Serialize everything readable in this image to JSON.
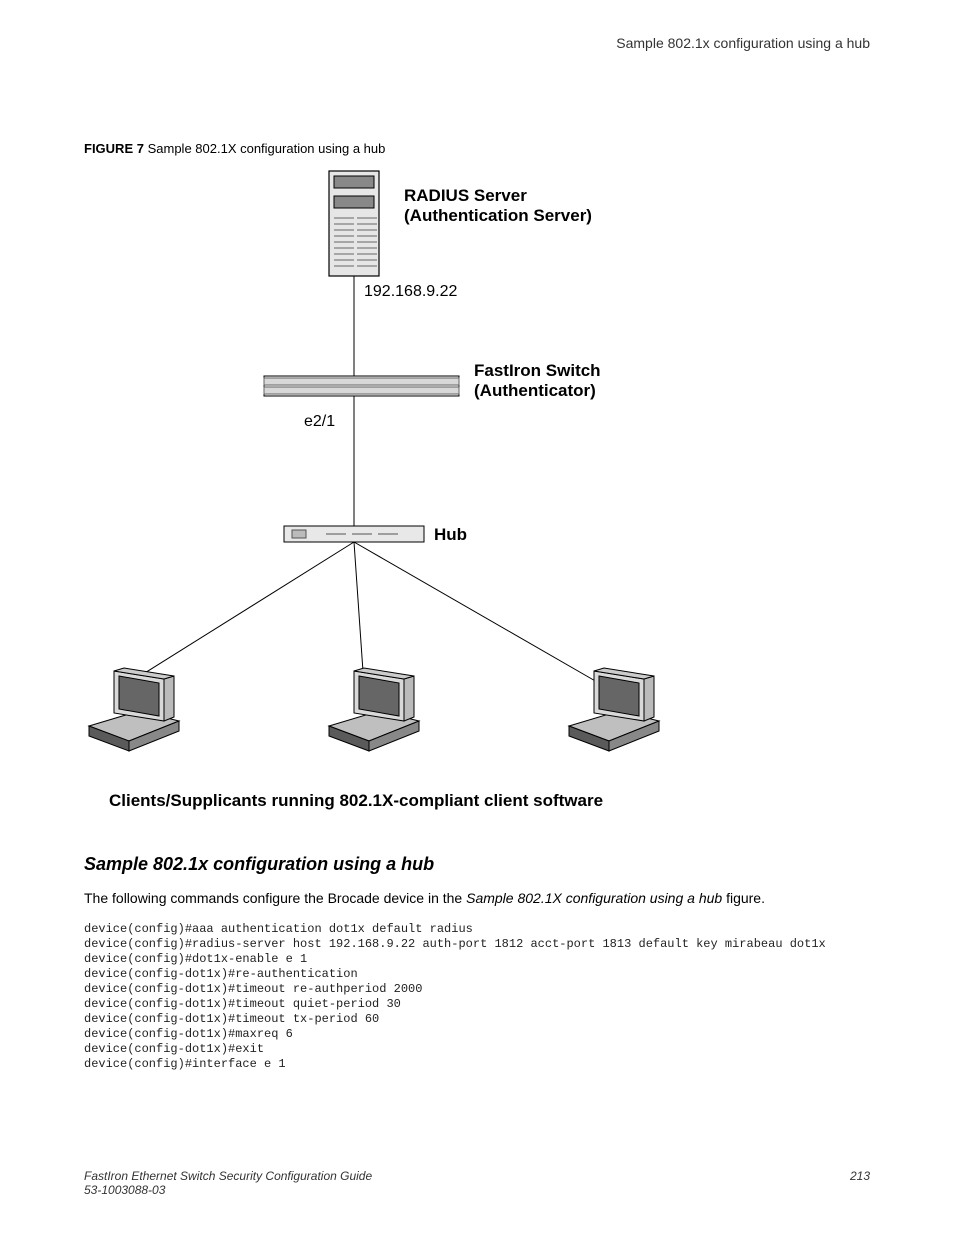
{
  "header": {
    "right_text": "Sample 802.1x configuration using a hub"
  },
  "figure": {
    "label": "FIGURE 7",
    "caption": "Sample 802.1X configuration using a hub",
    "labels": {
      "radius_title": "RADIUS Server",
      "radius_sub": "(Authentication Server)",
      "ip": "192.168.9.22",
      "switch_title": "FastIron Switch",
      "switch_sub": "(Authenticator)",
      "port": "e2/1",
      "hub": "Hub",
      "clients": "Clients/Supplicants running 802.1X-compliant client software"
    }
  },
  "section": {
    "heading": "Sample 802.1x configuration using a hub",
    "intro_a": "The following commands configure the Brocade device in the ",
    "intro_ital": "Sample 802.1X configuration using a hub",
    "intro_b": " figure.",
    "code": "device(config)#aaa authentication dot1x default radius\ndevice(config)#radius-server host 192.168.9.22 auth-port 1812 acct-port 1813 default key mirabeau dot1x\ndevice(config)#dot1x-enable e 1\ndevice(config-dot1x)#re-authentication\ndevice(config-dot1x)#timeout re-authperiod 2000\ndevice(config-dot1x)#timeout quiet-period 30\ndevice(config-dot1x)#timeout tx-period 60\ndevice(config-dot1x)#maxreq 6\ndevice(config-dot1x)#exit\ndevice(config)#interface e 1"
  },
  "footer": {
    "title": "FastIron Ethernet Switch Security Configuration Guide",
    "docnum": "53-1003088-03",
    "page": "213"
  }
}
